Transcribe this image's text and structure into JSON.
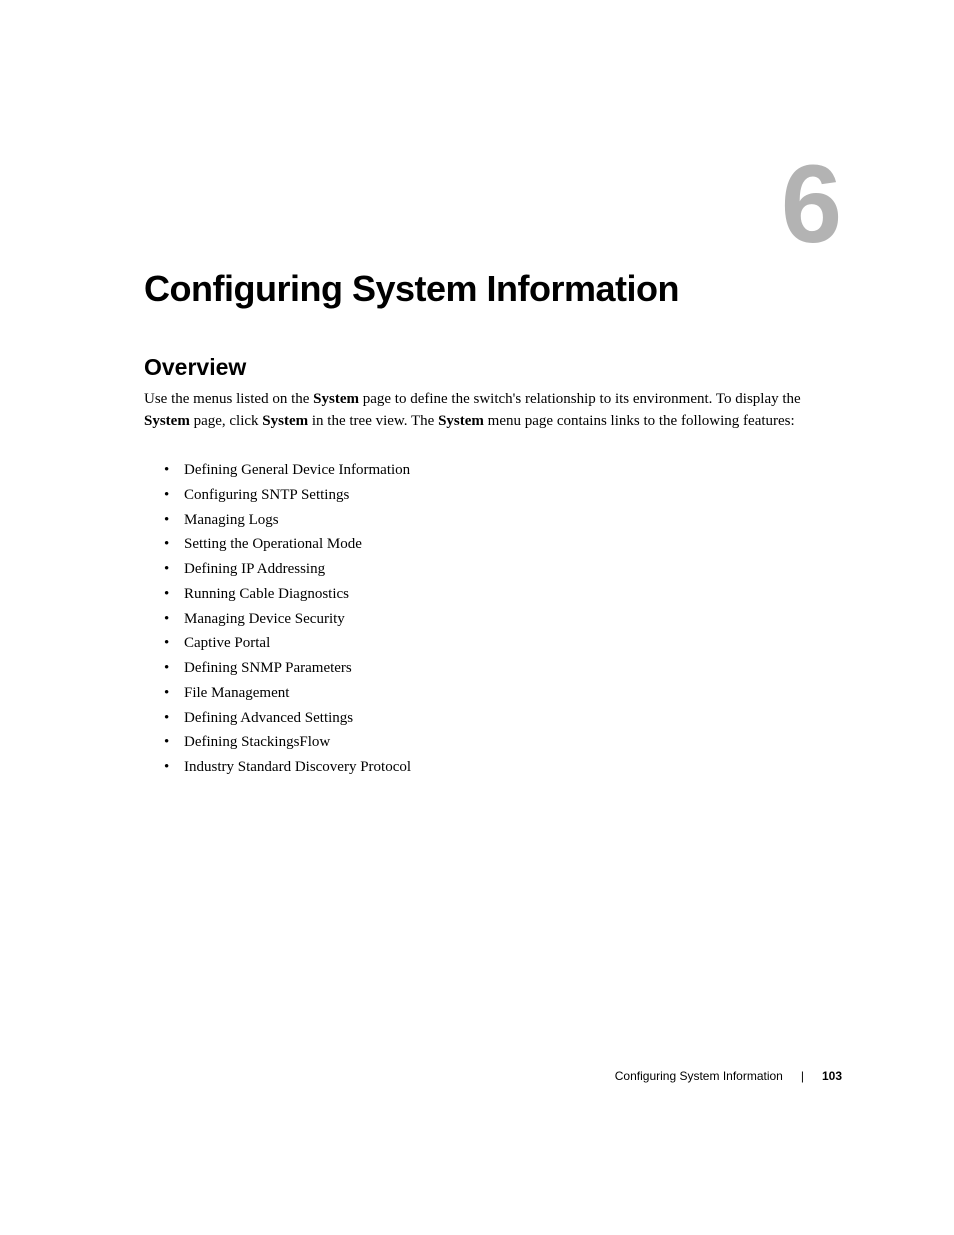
{
  "chapter": {
    "number": "6",
    "title": "Configuring System Information"
  },
  "section": {
    "heading": "Overview",
    "intro_parts": [
      "Use the menus listed on the ",
      "System",
      " page to define the switch's relationship to its environment. To display the ",
      "System",
      " page, click ",
      "System",
      " in the tree view. The ",
      "System",
      " menu page contains links to the following features:"
    ]
  },
  "features": [
    "Defining General Device Information",
    "Configuring SNTP Settings",
    "Managing Logs",
    "Setting the Operational Mode",
    "Defining IP Addressing",
    "Running Cable Diagnostics",
    "Managing Device Security",
    "Captive Portal",
    "Defining SNMP Parameters",
    "File Management",
    "Defining Advanced Settings",
    "Defining StackingsFlow",
    "Industry Standard Discovery Protocol"
  ],
  "footer": {
    "title": "Configuring System Information",
    "page": "103"
  }
}
